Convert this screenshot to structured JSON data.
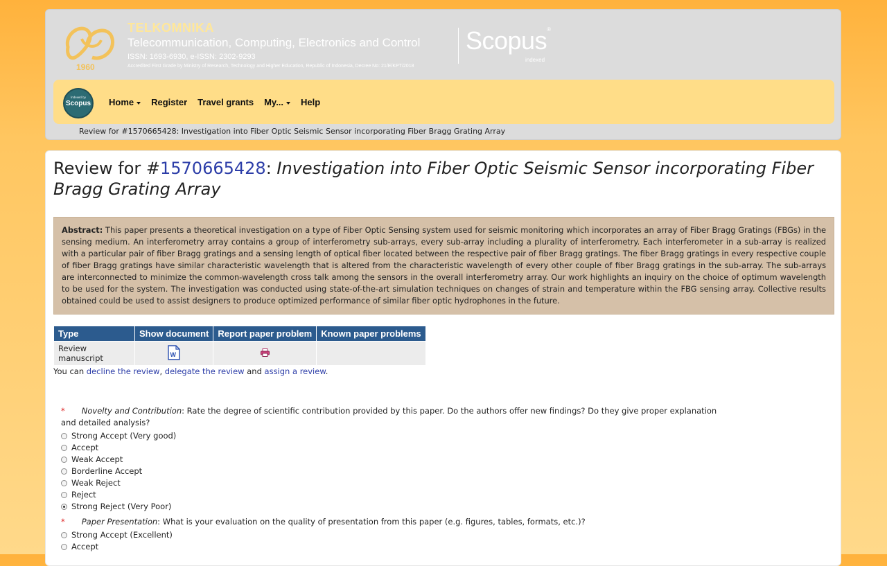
{
  "header": {
    "logo_year": "1960",
    "brand_name": "TELKOMNIKA",
    "brand_subtitle": "Telecommunication, Computing, Electronics and Control",
    "issn": "ISSN: 1693-6930, e-ISSN: 2302-9293",
    "accreditation": "Accredited First Grade by Ministry of Research, Technology and Higher Education, Republic of Indonesia, Decree No: 21/E/KPT/2018",
    "scopus_label": "Scopus",
    "scopus_sup": "®",
    "scopus_indexed": "indexed"
  },
  "navbar": {
    "badge_small": "Indexed by",
    "badge_big": "Scopus",
    "items": [
      {
        "label": "Home",
        "dropdown": true
      },
      {
        "label": "Register",
        "dropdown": false
      },
      {
        "label": "Travel grants",
        "dropdown": false
      },
      {
        "label": "My...",
        "dropdown": true
      },
      {
        "label": "Help",
        "dropdown": false
      }
    ]
  },
  "breadcrumb": "Review for #1570665428: Investigation into Fiber Optic Seismic Sensor incorporating Fiber Bragg Grating Array",
  "title": {
    "prefix": "Review for #",
    "paper_id": "1570665428",
    "colon": ": ",
    "paper_title": "Investigation into Fiber Optic Seismic Sensor incorporating Fiber Bragg Grating Array"
  },
  "abstract": {
    "label": "Abstract:",
    "text": " This paper presents a theoretical investigation on a type of Fiber Optic Sensing system used for seismic monitoring which incorporates an array of Fiber Bragg Gratings (FBGs) in the sensing medium. An interferometry array contains a group of interferometry sub-arrays, every sub-array including a plurality of interferometry. Each interferometer in a sub-array is realized with a particular pair of fiber Bragg gratings and a sensing length of optical fiber located between the respective pair of fiber Bragg gratings. The fiber Bragg gratings in every respective couple of fiber Bragg gratings have similar characteristic wavelength that is altered from the characteristic wavelength of every other couple of fiber Bragg gratings in the sub-array. The sub-arrays are interconnected to minimize the common-wavelength cross talk among the sensors in the overall interferometry array. Our work highlights an inquiry on the choice of optimum wavelength to be used for the system. The investigation was conducted using state-of-the-art simulation techniques on changes of strain and temperature within the FBG sensing array. Collective results obtained could be used to assist designers to produce optimized performance of similar fiber optic hydrophones in the future."
  },
  "doc_table": {
    "headers": [
      "Type",
      "Show document",
      "Report paper problem",
      "Known paper problems"
    ],
    "row": {
      "type": "Review manuscript",
      "doc_icon": "word-doc-icon",
      "report_icon": "printer-icon",
      "known": ""
    }
  },
  "actions": {
    "prefix": "You can ",
    "decline": "decline the review",
    "sep1": ", ",
    "delegate": "delegate the review",
    "sep2": " and ",
    "assign": "assign a review",
    "suffix": "."
  },
  "questions": [
    {
      "required": "*",
      "title": "Novelty and Contribution",
      "text": ": Rate the degree of scientific contribution provided by this paper. Do the authors offer new findings? Do they give proper explanation and detailed analysis?",
      "options": [
        "Strong Accept (Very good)",
        "Accept",
        "Weak Accept",
        "Borderline Accept",
        "Weak Reject",
        "Reject",
        "Strong Reject (Very Poor)"
      ],
      "selected": "Strong Reject (Very Poor)"
    },
    {
      "required": "*",
      "title": "Paper Presentation",
      "text": ": What is your evaluation on the quality of presentation from this paper (e.g. figures, tables, formats, etc.)?",
      "options": [
        "Strong Accept (Excellent)",
        "Accept"
      ],
      "selected": ""
    }
  ],
  "colors": {
    "nav_bg": "#ffdd88",
    "table_header": "#2c5b8e",
    "abstract_bg": "#d5c0a8",
    "link": "#2c3da8"
  }
}
